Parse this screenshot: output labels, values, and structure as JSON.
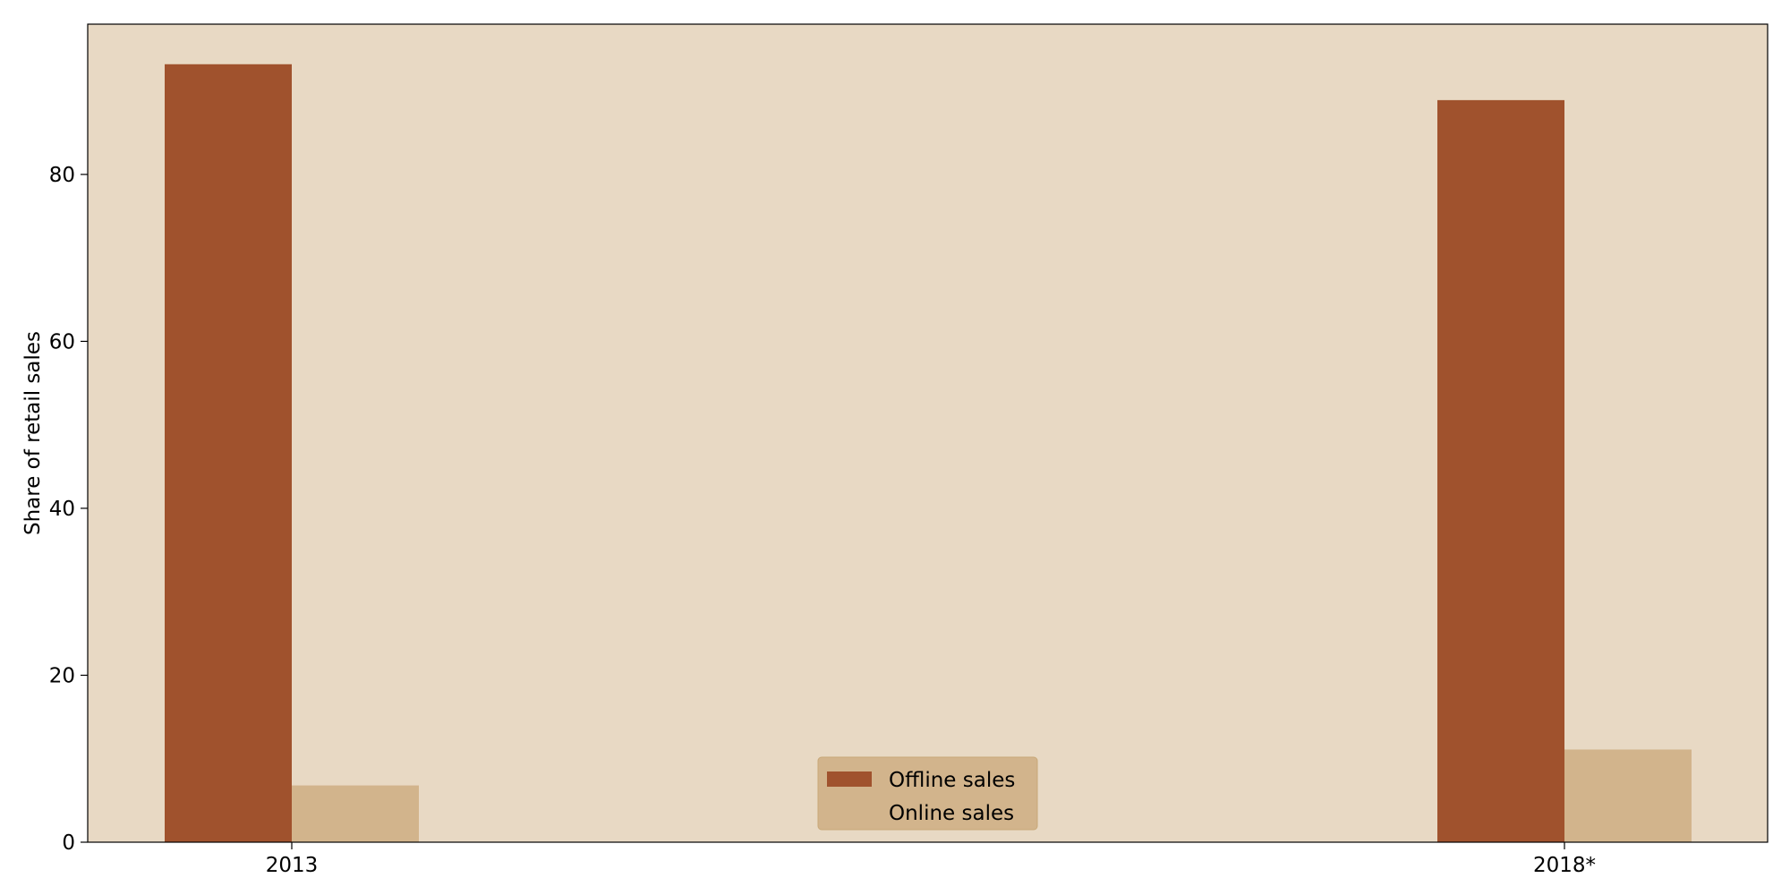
{
  "chart_data": {
    "type": "bar",
    "categories": [
      "2013",
      "2018*"
    ],
    "series": [
      {
        "name": "Offline sales",
        "values": [
          93.2,
          88.9
        ],
        "color": "#a0522d"
      },
      {
        "name": "Online sales",
        "values": [
          6.8,
          11.1
        ],
        "color": "#d2b48c"
      }
    ],
    "title": "",
    "xlabel": "",
    "ylabel": "Share of retail sales",
    "ylim": [
      0,
      98
    ],
    "yticks": [
      0,
      20,
      40,
      60,
      80
    ],
    "grid": false,
    "legend_position": "bottom-center",
    "plot_background": "#e8d9c4",
    "legend_background": "#d2b48c"
  }
}
